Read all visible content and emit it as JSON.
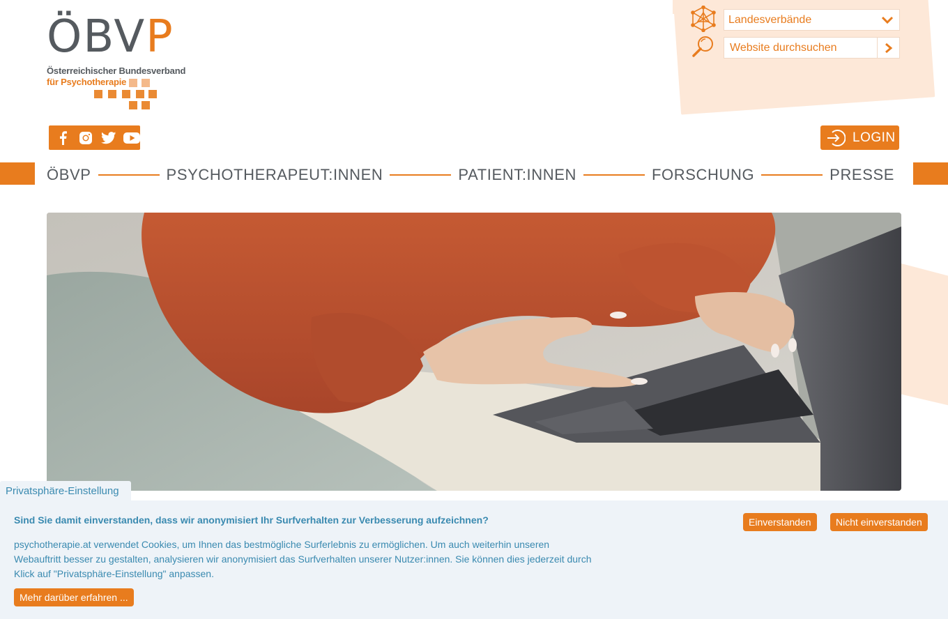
{
  "logo": {
    "letters_main": "ÖBV",
    "letters_accent": "P",
    "line1": "Österreichischer Bundesverband",
    "line2": "für Psychotherapie"
  },
  "header": {
    "landesverbaende": {
      "selected": "Landesverbände",
      "icon": "network-icon"
    },
    "search": {
      "placeholder": "Website durchsuchen",
      "icon": "magnifier-icon",
      "submit_icon": "chevron-right-icon"
    },
    "social": [
      "facebook-icon",
      "instagram-icon",
      "twitter-icon",
      "youtube-icon"
    ],
    "login_label": "LOGIN"
  },
  "nav": {
    "items": [
      "ÖBVP",
      "PSYCHOTHERAPEUT:INNEN",
      "PATIENT:INNEN",
      "FORSCHUNG",
      "PRESSE"
    ]
  },
  "cookie": {
    "tab_label": "Privatsphäre-Einstellung",
    "question": "Sind Sie damit einverstanden, dass wir anonymisiert Ihr Surfverhalten zur Verbesserung aufzeichnen?",
    "text": "psychotherapie.at verwendet Cookies, um Ihnen das bestmögliche Surferlebnis zu  ermöglichen. Um auch weiterhin unseren Webauftritt besser zu gestalten, analysieren wir anonymisiert das Surfverhalten unserer Nutzer:innen. Sie können dies jederzeit durch Klick auf \"Privatsphäre-Einstellung\" anpassen.",
    "more_label": "Mehr darüber erfahren ...",
    "accept_label": "Einverstanden",
    "decline_label": "Nicht einverstanden"
  },
  "colors": {
    "accent": "#e87c1e",
    "text_grey": "#555a5f",
    "cookie_text": "#3a8ab0",
    "cookie_bg": "#eef3f8",
    "peach": "#fde8d8"
  }
}
